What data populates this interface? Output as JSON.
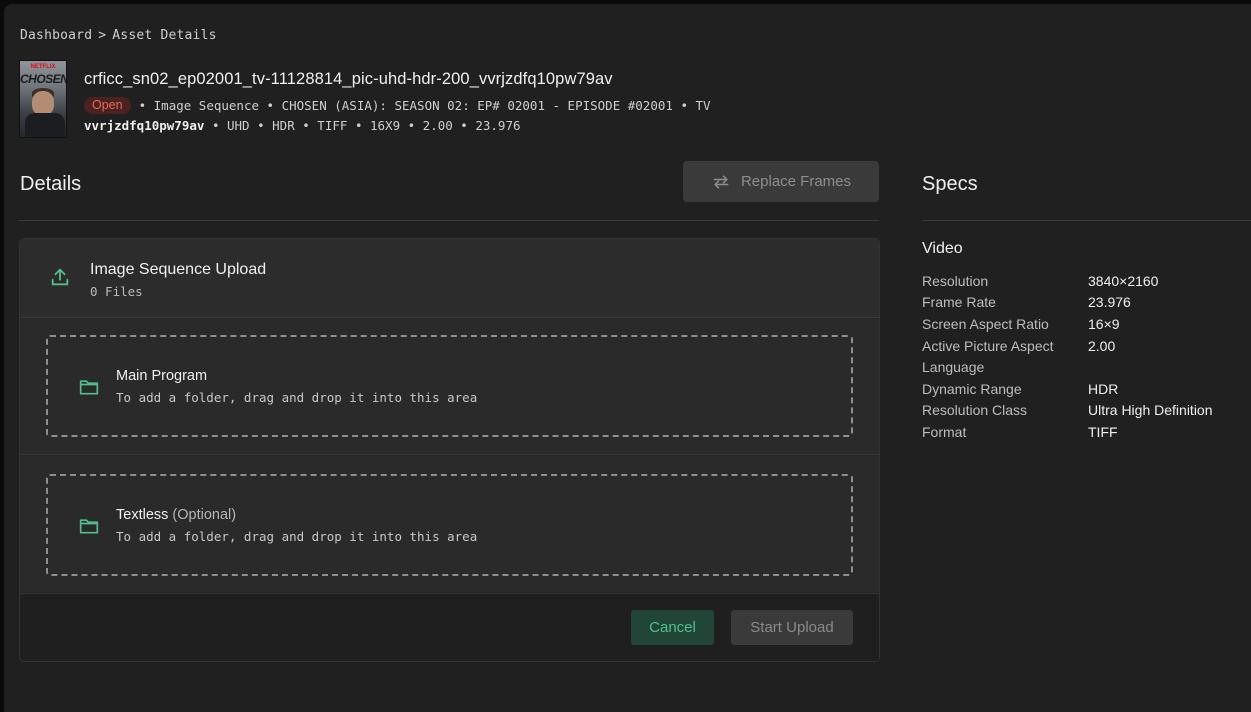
{
  "breadcrumb": {
    "items": [
      "Dashboard",
      ">",
      "Asset Details"
    ]
  },
  "poster": {
    "brand": "NETFLIX",
    "title": "CHOSEN"
  },
  "asset": {
    "title": "crficc_sn02_ep02001_tv-11128814_pic-uhd-hdr-200_vvrjzdfq10pw79av",
    "status": "Open",
    "meta_line": "• Image Sequence • CHOSEN (ASIA): SEASON 02: EP# 02001 - EPISODE #02001 • TV",
    "meta_id": "vvrjzdfq10pw79av",
    "meta_specs": "• UHD • HDR • TIFF • 16X9 • 2.00 • 23.976"
  },
  "details": {
    "title": "Details",
    "replace_label": "Replace Frames"
  },
  "upload": {
    "title": "Image Sequence Upload",
    "files": "0 Files",
    "zones": [
      {
        "title": "Main Program",
        "optional": "",
        "hint": "To add a folder, drag and drop it into this area"
      },
      {
        "title": "Textless",
        "optional": "(Optional)",
        "hint": "To add a folder, drag and drop it into this area"
      }
    ],
    "cancel_label": "Cancel",
    "start_label": "Start Upload"
  },
  "specs": {
    "title": "Specs",
    "section": "Video",
    "rows": [
      {
        "key": "Resolution",
        "value": "3840×2160"
      },
      {
        "key": "Frame Rate",
        "value": "23.976"
      },
      {
        "key": "Screen Aspect Ratio",
        "value": "16×9"
      },
      {
        "key": "Active Picture Aspect",
        "value": "2.00"
      },
      {
        "key": "Language",
        "value": ""
      },
      {
        "key": "Dynamic Range",
        "value": "HDR"
      },
      {
        "key": "Resolution Class",
        "value": "Ultra High Definition"
      },
      {
        "key": "Format",
        "value": "TIFF"
      }
    ]
  },
  "colors": {
    "accent": "#4fc08d",
    "status_open": "#f0665c",
    "background": "#202020"
  },
  "icons": [
    "upload-icon",
    "folder-icon",
    "swap-arrows-icon"
  ]
}
